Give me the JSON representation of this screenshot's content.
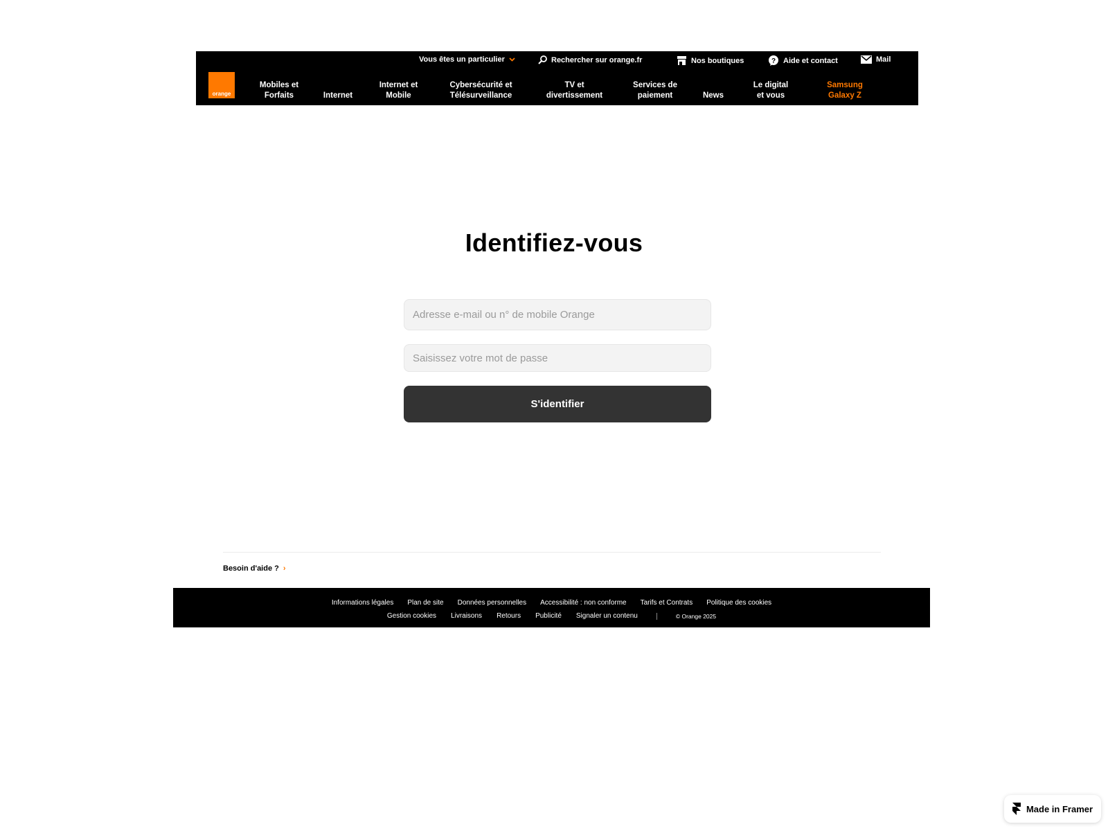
{
  "header": {
    "logo_text": "orange",
    "top": {
      "segment": "Vous êtes un particulier",
      "search": "Rechercher sur orange.fr",
      "shops": "Nos boutiques",
      "help": "Aide et contact",
      "mail": "Mail"
    },
    "nav": [
      {
        "l1": "Mobiles et",
        "l2": "Forfaits"
      },
      {
        "l1": "",
        "l2": "Internet"
      },
      {
        "l1": "Internet et",
        "l2": "Mobile"
      },
      {
        "l1": "Cybersécurité et",
        "l2": "Télésurveillance"
      },
      {
        "l1": "TV et",
        "l2": "divertissement"
      },
      {
        "l1": "Services de",
        "l2": "paiement"
      },
      {
        "l1": "",
        "l2": "News"
      },
      {
        "l1": "Le digital",
        "l2": "et vous"
      },
      {
        "l1": "Samsung",
        "l2": "Galaxy Z"
      }
    ]
  },
  "main": {
    "title": "Identifiez-vous",
    "email_placeholder": "Adresse e-mail ou n° de mobile Orange",
    "password_placeholder": "Saisissez votre mot de passe",
    "submit_label": "S'identifier"
  },
  "help": {
    "label": "Besoin d'aide ?",
    "chevron": "›"
  },
  "footer": {
    "row1": [
      "Informations légales",
      "Plan de site",
      "Données personnelles",
      "Accessibilité : non conforme",
      "Tarifs et Contrats",
      "Politique des cookies"
    ],
    "row2": [
      "Gestion cookies",
      "Livraisons",
      "Retours",
      "Publicité",
      "Signaler un contenu"
    ],
    "copyright": "© Orange 2025"
  },
  "framer_badge": "Made in Framer",
  "colors": {
    "brand_orange": "#ff7900",
    "header_bg": "#000000",
    "button_bg": "#333333"
  }
}
